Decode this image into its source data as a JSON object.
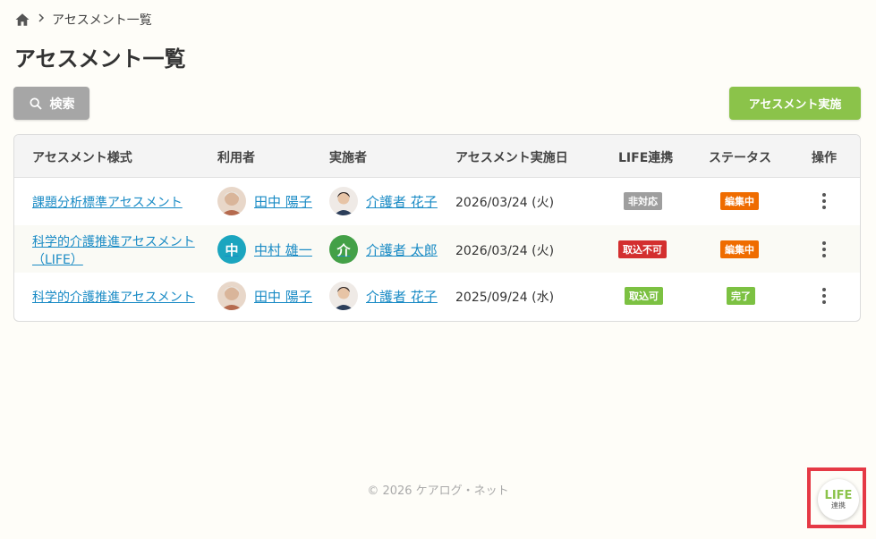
{
  "breadcrumb": {
    "home_icon": "home-icon",
    "separator_icon": "chevron-right-icon",
    "current": "アセスメント一覧"
  },
  "page_title": "アセスメント一覧",
  "toolbar": {
    "search_label": "検索",
    "search_icon": "search-icon",
    "execute_label": "アセスメント実施"
  },
  "table": {
    "headers": [
      "アセスメント様式",
      "利用者",
      "実施者",
      "アセスメント実施日",
      "LIFE連携",
      "ステータス",
      "操作"
    ],
    "rows": [
      {
        "form": "課題分析標準アセスメント",
        "user": {
          "name": "田中 陽子",
          "avatar": "photo-elderly-woman"
        },
        "staff": {
          "name": "介護者 花子",
          "avatar": "photo-caregiver"
        },
        "date": "2026/03/24 (火)",
        "life": {
          "label": "非対応",
          "color": "#9e9e9e"
        },
        "status": {
          "label": "編集中",
          "color": "#ef6c00"
        }
      },
      {
        "form": "科学的介護推進アセスメント（LIFE）",
        "user": {
          "name": "中村 雄一",
          "avatar_letter": "中",
          "avatar_color": "#1ba5bf"
        },
        "staff": {
          "name": "介護者 太郎",
          "avatar_letter": "介",
          "avatar_color": "#43a047"
        },
        "date": "2026/03/24 (火)",
        "life": {
          "label": "取込不可",
          "color": "#d32f2f"
        },
        "status": {
          "label": "編集中",
          "color": "#ef6c00"
        }
      },
      {
        "form": "科学的介護推進アセスメント",
        "user": {
          "name": "田中 陽子",
          "avatar": "photo-elderly-woman"
        },
        "staff": {
          "name": "介護者 花子",
          "avatar": "photo-caregiver"
        },
        "date": "2025/09/24 (水)",
        "life": {
          "label": "取込可",
          "color": "#7cc142"
        },
        "status": {
          "label": "完了",
          "color": "#7cc142"
        }
      }
    ]
  },
  "footer": "© 2026 ケアログ・ネット",
  "life_button": {
    "line1": "LIFE",
    "line2": "連携",
    "highlight_color": "#e53945"
  },
  "colors": {
    "accent_green": "#8bc34a",
    "link_blue": "#1a8bc5",
    "search_gray": "#a6a6a6"
  }
}
